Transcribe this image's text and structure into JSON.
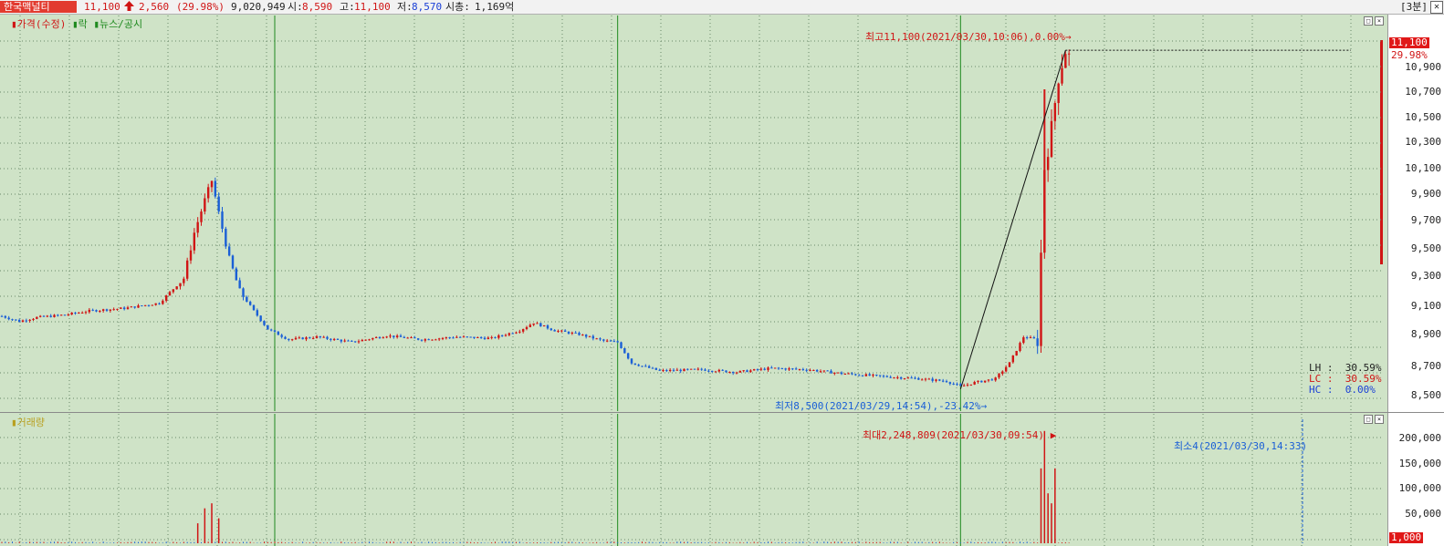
{
  "header": {
    "stock_name": "한국맥널티",
    "price": "11,100",
    "change_arrow": "up-arrow-icon",
    "change": "2,560",
    "change_pct": "(29.98%)",
    "volume": "9,020,949",
    "open_label": "시:",
    "open": "8,590",
    "high_label": "고:",
    "high": "11,100",
    "low_label": "저:",
    "low": "8,570",
    "mcap_label": "시총:",
    "mcap": "1,169억",
    "timeframe": "[3분]",
    "close_symbol": "✕"
  },
  "price_pane": {
    "legend": [
      "가격(수정)",
      "락",
      "뉴스/공시"
    ],
    "high_annotation": "최고11,100(2021/03/30,10:06),0.00%",
    "low_annotation": "최저8,500(2021/03/29,14:54),-23.42%",
    "current_price_tag": "11,100",
    "current_pct_tag": "29.98%",
    "axis_labels": [
      "10,900",
      "10,700",
      "10,500",
      "10,300",
      "10,100",
      "9,900",
      "9,700",
      "9,500",
      "9,300",
      "9,100",
      "8,900",
      "8,700",
      "8,500"
    ],
    "stats": [
      {
        "label": "LH",
        "value": "30.59%",
        "color": "#222222"
      },
      {
        "label": "LC",
        "value": "30.59%",
        "color": "#d01515"
      },
      {
        "label": "HC",
        "value": "0.00%",
        "color": "#1a3fd6"
      }
    ]
  },
  "volume_pane": {
    "legend": "거래량",
    "max_annotation": "최대2,248,809(2021/03/30,09:54)",
    "min_annotation": "최소4(2021/03/30,14:33)",
    "axis_labels": [
      "200,000",
      "150,000",
      "100,000",
      "50,000"
    ],
    "bottom_tag": "1,000"
  },
  "colors": {
    "background": "#cfe3c7",
    "up": "#d01515",
    "down": "#1a5fd6",
    "session_divider": "#1f8a1f",
    "grid": "#6a8a6a"
  },
  "chart_data": {
    "type": "candlestick",
    "price_ylim": [
      8450,
      11150
    ],
    "volume_ylim": [
      0,
      230000
    ],
    "session_breaks_at_bar": [
      78,
      176,
      274
    ],
    "price_path": [
      [
        0,
        9060
      ],
      [
        5,
        9020
      ],
      [
        10,
        9050
      ],
      [
        18,
        9070
      ],
      [
        25,
        9100
      ],
      [
        35,
        9120
      ],
      [
        45,
        9160
      ],
      [
        52,
        9350
      ],
      [
        55,
        9700
      ],
      [
        58,
        9950
      ],
      [
        60,
        10100
      ],
      [
        62,
        9850
      ],
      [
        65,
        9500
      ],
      [
        68,
        9250
      ],
      [
        72,
        9100
      ],
      [
        76,
        8960
      ],
      [
        82,
        8880
      ],
      [
        90,
        8900
      ],
      [
        100,
        8860
      ],
      [
        110,
        8910
      ],
      [
        120,
        8880
      ],
      [
        130,
        8900
      ],
      [
        140,
        8890
      ],
      [
        148,
        8950
      ],
      [
        152,
        9010
      ],
      [
        158,
        8950
      ],
      [
        165,
        8920
      ],
      [
        172,
        8870
      ],
      [
        176,
        8860
      ],
      [
        180,
        8700
      ],
      [
        188,
        8640
      ],
      [
        200,
        8650
      ],
      [
        210,
        8630
      ],
      [
        220,
        8660
      ],
      [
        230,
        8650
      ],
      [
        240,
        8620
      ],
      [
        250,
        8600
      ],
      [
        262,
        8580
      ],
      [
        270,
        8560
      ],
      [
        274,
        8520
      ],
      [
        278,
        8550
      ],
      [
        284,
        8580
      ],
      [
        288,
        8700
      ],
      [
        292,
        8900
      ],
      [
        296,
        8880
      ],
      [
        298,
        10200
      ],
      [
        300,
        10500
      ],
      [
        302,
        10900
      ],
      [
        304,
        11100
      ],
      [
        305,
        11050
      ]
    ],
    "volume_spikes": [
      {
        "bar": 56,
        "value": 40000
      },
      {
        "bar": 58,
        "value": 70000
      },
      {
        "bar": 60,
        "value": 80000
      },
      {
        "bar": 62,
        "value": 50000
      },
      {
        "bar": 297,
        "value": 150000
      },
      {
        "bar": 298,
        "value": 224880
      },
      {
        "bar": 299,
        "value": 100000
      },
      {
        "bar": 300,
        "value": 80000
      },
      {
        "bar": 301,
        "value": 150000
      }
    ]
  }
}
